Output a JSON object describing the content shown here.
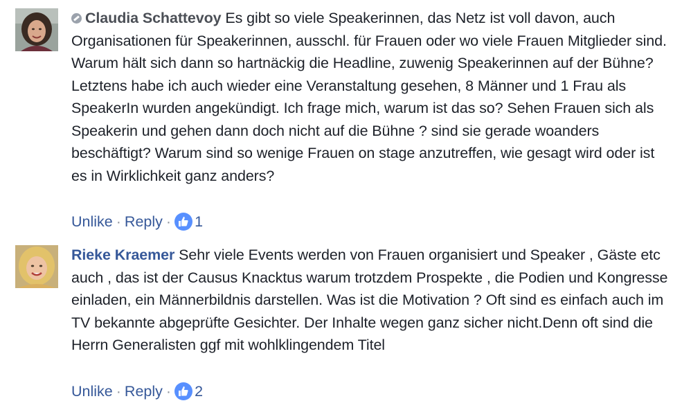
{
  "comments": [
    {
      "author": "Claudia Schattevoy",
      "text": "Es gibt so viele Speakerinnen, das Netz ist voll davon, auch Organisationen für Speakerinnen, ausschl. für Frauen oder wo viele Frauen Mitglieder sind. Warum hält sich dann so hartnäckig die Headline, zuwenig Speakerinnen auf der Bühne? Letztens habe ich auch wieder eine Veranstaltung gesehen, 8 Männer und 1 Frau als SpeakerIn wurden angekündigt. Ich frage mich, warum ist das so? Sehen Frauen sich als Speakerin und gehen dann doch nicht auf die Bühne ? sind sie gerade woanders beschäftigt? Warum sind so wenige Frauen on stage anzutreffen, wie gesagt wird oder ist es in Wirklichkeit ganz anders?",
      "unlike_label": "Unlike",
      "reply_label": "Reply",
      "like_count": "1"
    },
    {
      "author": "Rieke Kraemer",
      "text": "Sehr viele Events werden von Frauen organisiert und Speaker , Gäste etc auch , das ist der Causus Knacktus warum trotzdem Prospekte , die Podien und Kongresse einladen, ein Männerbildnis darstellen. Was ist die Motivation ? Oft sind es einfach auch im TV bekannte abgeprüfte Gesichter. Der Inhalte wegen ganz sicher nicht.Denn oft sind die Herrn Generalisten ggf mit wohlklingendem Titel",
      "unlike_label": "Unlike",
      "reply_label": "Reply",
      "like_count": "2"
    }
  ],
  "separator": "·",
  "colors": {
    "link": "#365899",
    "text": "#1d2129",
    "muted": "#90949c",
    "like_badge": "#5890ff"
  },
  "icons": {
    "status": "checkmark-dot-icon",
    "like": "thumbs-up-icon"
  }
}
